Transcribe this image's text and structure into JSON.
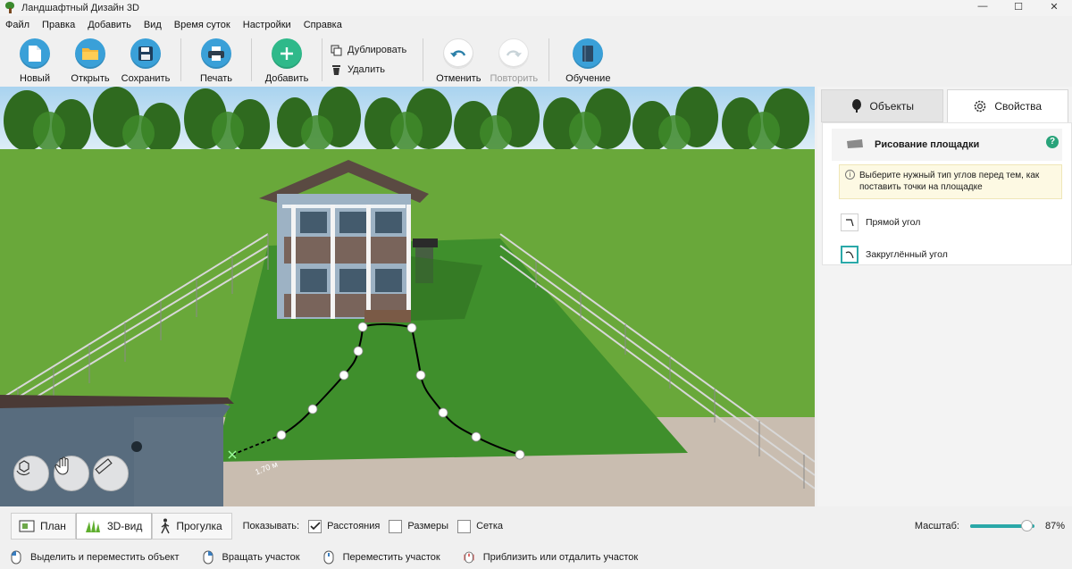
{
  "window": {
    "title": "Ландшафтный Дизайн 3D",
    "minimize": "—",
    "maximize": "☐",
    "close": "✕"
  },
  "menu": [
    "Файл",
    "Правка",
    "Добавить",
    "Вид",
    "Время суток",
    "Настройки",
    "Справка"
  ],
  "toolbar": {
    "new": "Новый",
    "open": "Открыть",
    "save": "Сохранить",
    "print": "Печать",
    "add": "Добавить",
    "duplicate": "Дублировать",
    "delete": "Удалить",
    "undo": "Отменить",
    "redo": "Повторить",
    "learn": "Обучение"
  },
  "viewport": {
    "distance_label": "1.70 м"
  },
  "panel": {
    "tabs": {
      "objects": "Объекты",
      "properties": "Свойства"
    },
    "section_title": "Рисование площадки",
    "help": "?",
    "hint": "Выберите нужный тип углов перед тем, как поставить точки на площадке",
    "options": {
      "straight": "Прямой угол",
      "rounded": "Закруглённый угол"
    }
  },
  "bottombar": {
    "views": {
      "plan": "План",
      "view3d": "3D-вид",
      "walk": "Прогулка"
    },
    "show_label": "Показывать:",
    "checks": {
      "distances": "Расстояния",
      "sizes": "Размеры",
      "grid": "Сетка"
    },
    "distances_checked": true,
    "sizes_checked": false,
    "grid_checked": false,
    "zoom_label": "Масштаб:",
    "zoom_value": "87%",
    "zoom_fraction": 0.87
  },
  "statusbar": {
    "select": "Выделить и переместить объект",
    "rotate": "Вращать участок",
    "move": "Переместить участок",
    "zoom": "Приблизить или отдалить участок"
  },
  "colors": {
    "accent": "#2aa8a8",
    "toolbar_blue": "#3aa0d8",
    "add_green": "#2fb98a",
    "grass": "#3f8f2c",
    "lawn": "#4c9a2c"
  }
}
